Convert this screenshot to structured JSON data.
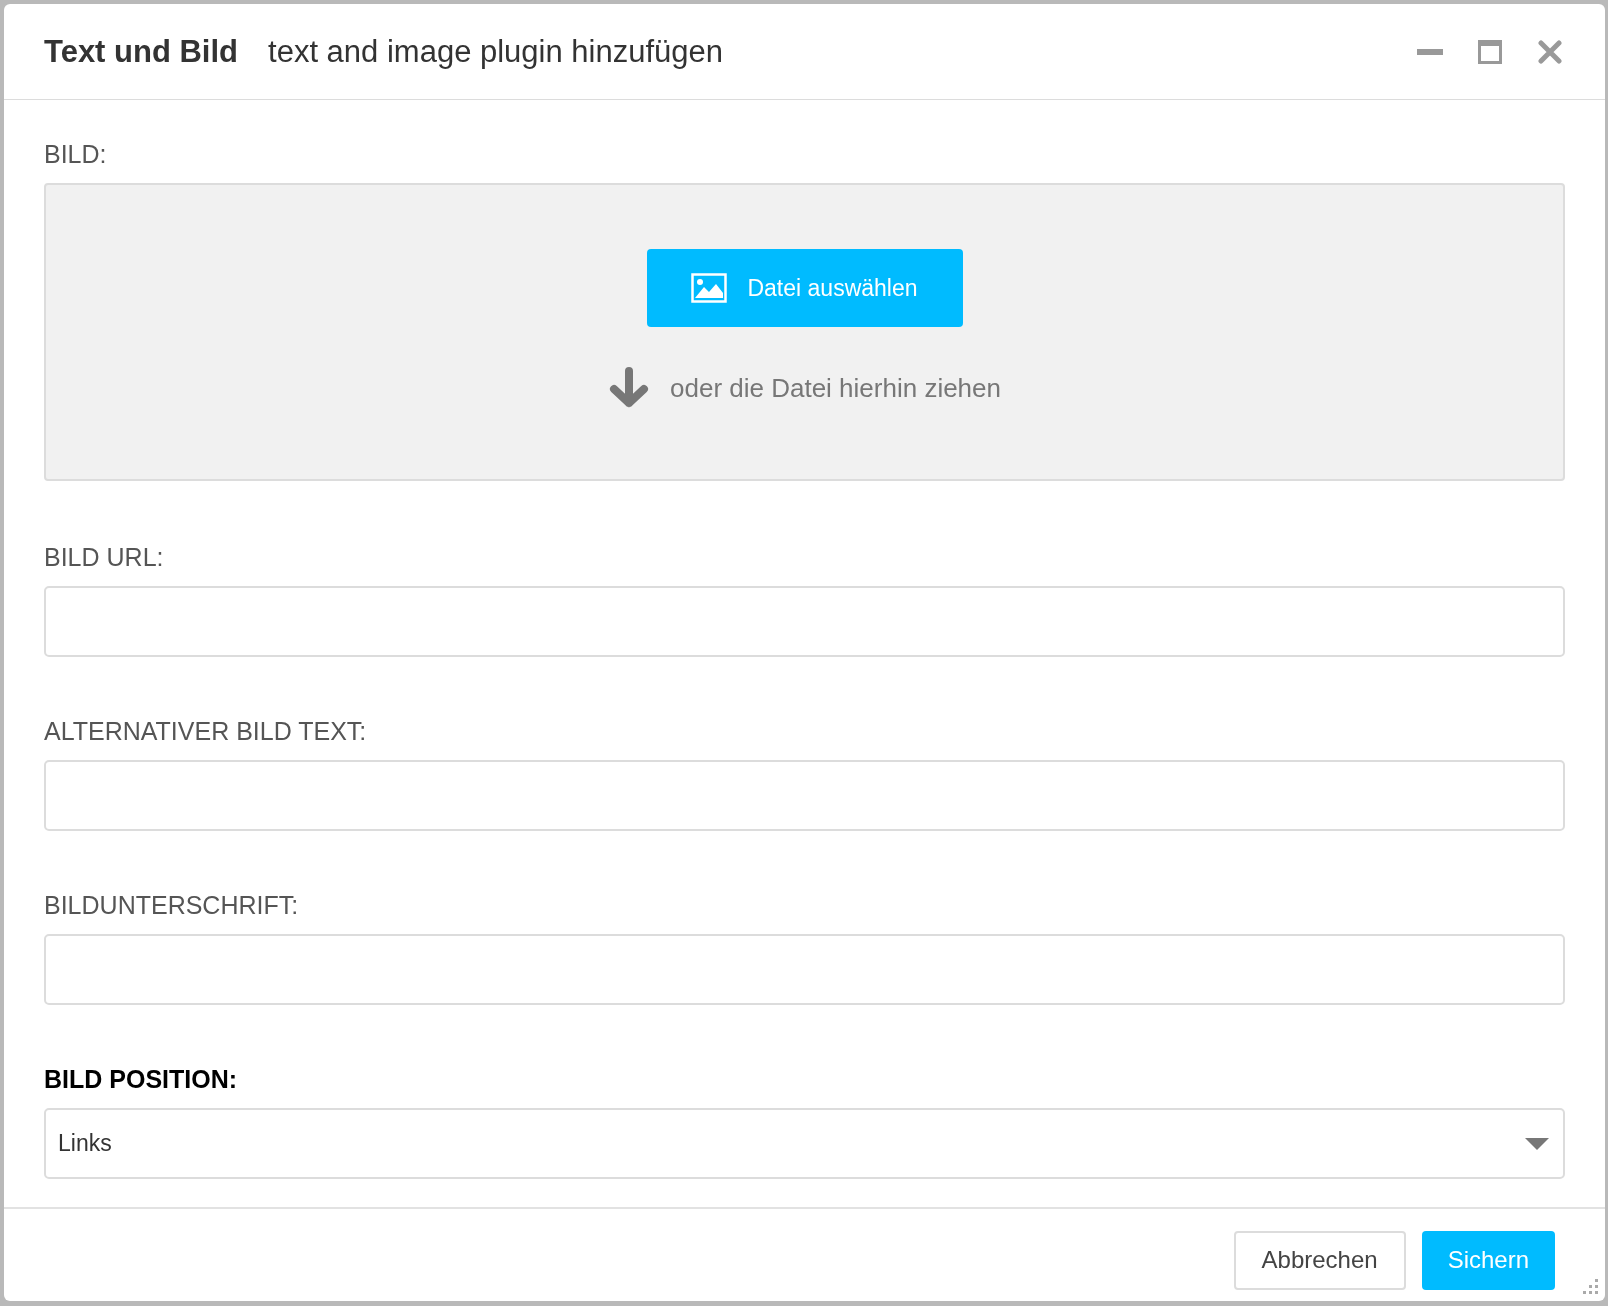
{
  "window": {
    "title": "Text und Bild",
    "subtitle": "text and image plugin hinzufügen"
  },
  "upload": {
    "label": "BILD:",
    "button": "Datei auswählen",
    "hint": "oder die Datei hierhin ziehen"
  },
  "fields": [
    {
      "kind": "text",
      "label": "BILD URL:",
      "required": false
    },
    {
      "kind": "text",
      "label": "ALTERNATIVER BILD TEXT:",
      "required": false
    },
    {
      "kind": "text",
      "label": "BILDUNTERSCHRIFT:",
      "required": false
    },
    {
      "kind": "select",
      "label": "BILD POSITION:",
      "required": true,
      "value": "Links"
    }
  ],
  "buttons": [
    {
      "kind": "secondary",
      "label": "Abbrechen"
    },
    {
      "kind": "primary",
      "label": "Sichern"
    }
  ]
}
